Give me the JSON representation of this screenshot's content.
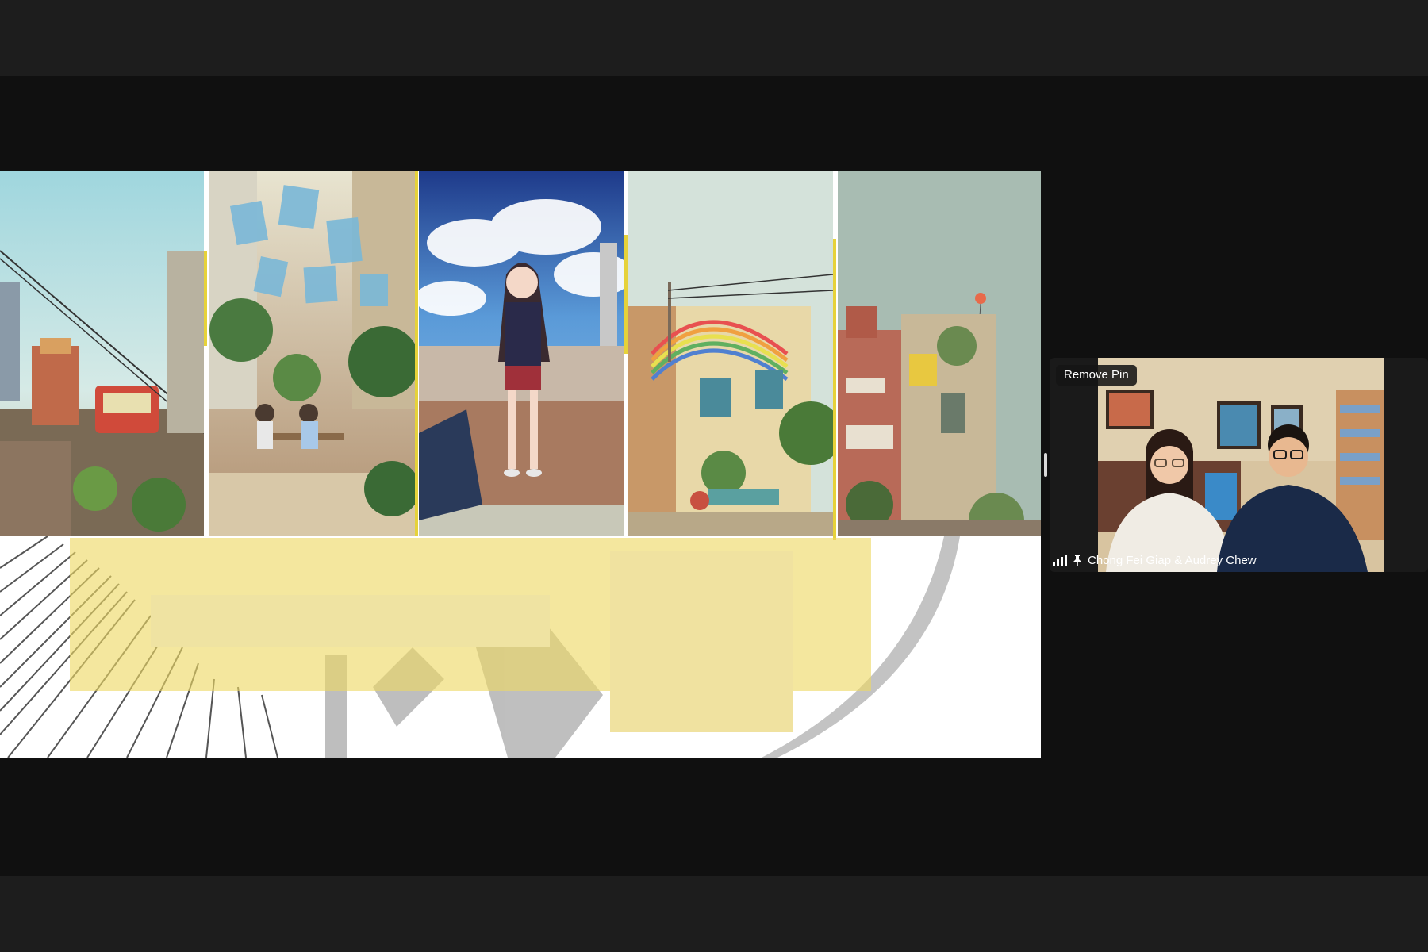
{
  "meeting": {
    "pinned_tile": {
      "remove_pin_label": "Remove Pin",
      "participant_name": "Chong Fei Giap & Audrey Chew",
      "signal_icon": "signal-bars-icon",
      "pin_icon": "pin-icon"
    },
    "shared_screen": {
      "panels": [
        "cable-car-city-illustration",
        "cafe-courtyard-illustration",
        "girl-on-rooftop-illustration",
        "rainbow-shophouse-illustration",
        "red-shophouse-balloon-illustration"
      ]
    }
  },
  "colors": {
    "background": "#101010",
    "toolbar": "#1d1d1d",
    "accent_yellow": "#e6d23a",
    "label_bg": "#141414"
  }
}
